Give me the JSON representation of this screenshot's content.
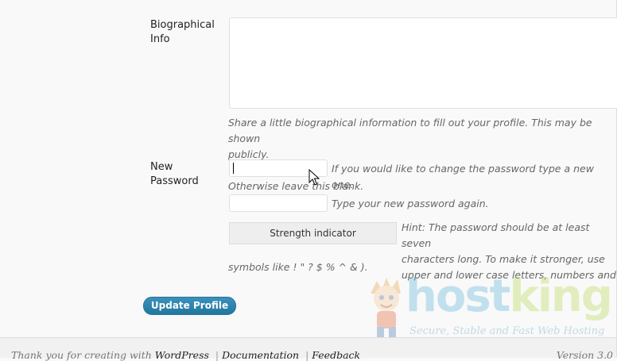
{
  "profile": {
    "bio_label": "Biographical Info",
    "bio_label_line1": "Biographical",
    "bio_label_line2": "Info",
    "bio_value": "",
    "bio_description_line1": "Share a little biographical information to fill out your profile. This may be shown",
    "bio_description_line2": "publicly.",
    "password_label_line1": "New",
    "password_label_line2": "Password",
    "pass1_value": "",
    "pass1_hint_line1": "If you would like to change the password type a new one.",
    "pass1_hint_line2": "Otherwise leave this blank.",
    "pass2_value": "",
    "pass2_hint": "Type your new password again.",
    "strength_indicator": "Strength indicator",
    "strength_hint_line1": "Hint: The password should be at least seven",
    "strength_hint_line2": "characters long. To make it stronger, use",
    "strength_hint_line3": "upper and lower case letters, numbers and",
    "strength_hint_line4": "symbols like ! \" ? $ % ^ & ).",
    "update_button": "Update Profile"
  },
  "watermark": {
    "brand_host": "host",
    "brand_king": "king",
    "tagline": "Secure, Stable and Fast Web Hosting"
  },
  "footer": {
    "thanks_text": "Thank you for creating with",
    "wordpress_link": "WordPress",
    "documentation_link": "Documentation",
    "feedback_link": "Feedback",
    "separator": "|",
    "version_text": "Version 3.0"
  },
  "colors": {
    "button_blue": "#22779e",
    "page_bg": "#f9f9f9",
    "hint_text": "#666666"
  }
}
